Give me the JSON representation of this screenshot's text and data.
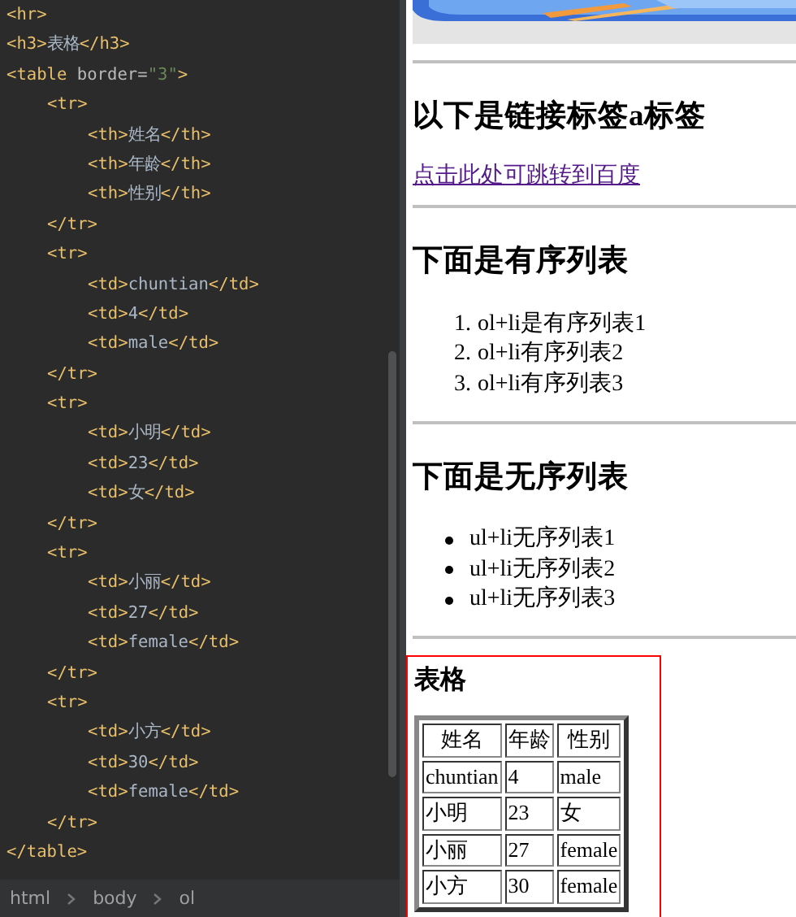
{
  "editor": {
    "lines": [
      {
        "tokens": [
          {
            "kind": "tag",
            "text": "<hr>"
          }
        ]
      },
      {
        "tokens": [
          {
            "kind": "tag",
            "text": "<h3>"
          },
          {
            "kind": "text",
            "text": "表格"
          },
          {
            "kind": "tag",
            "text": "</h3>"
          }
        ]
      },
      {
        "tokens": [
          {
            "kind": "tag",
            "text": "<table"
          },
          {
            "kind": "attr",
            "text": " border="
          },
          {
            "kind": "string",
            "text": "\"3\""
          },
          {
            "kind": "tag",
            "text": ">"
          }
        ],
        "children": [
          {
            "tokens": [
              {
                "kind": "tag",
                "text": "<tr>"
              }
            ],
            "children": [
              {
                "tokens": [
                  {
                    "kind": "tag",
                    "text": "<th>"
                  },
                  {
                    "kind": "text",
                    "text": "姓名"
                  },
                  {
                    "kind": "tag",
                    "text": "</th>"
                  }
                ]
              },
              {
                "tokens": [
                  {
                    "kind": "tag",
                    "text": "<th>"
                  },
                  {
                    "kind": "text",
                    "text": "年龄"
                  },
                  {
                    "kind": "tag",
                    "text": "</th>"
                  }
                ]
              },
              {
                "tokens": [
                  {
                    "kind": "tag",
                    "text": "<th>"
                  },
                  {
                    "kind": "text",
                    "text": "性别"
                  },
                  {
                    "kind": "tag",
                    "text": "</th>"
                  }
                ]
              }
            ]
          },
          {
            "tokens": [
              {
                "kind": "tag",
                "text": "</tr>"
              }
            ]
          },
          {
            "tokens": [
              {
                "kind": "tag",
                "text": "<tr>"
              }
            ],
            "children": [
              {
                "tokens": [
                  {
                    "kind": "tag",
                    "text": "<td>"
                  },
                  {
                    "kind": "text",
                    "text": "chuntian"
                  },
                  {
                    "kind": "tag",
                    "text": "</td>"
                  }
                ]
              },
              {
                "tokens": [
                  {
                    "kind": "tag",
                    "text": "<td>"
                  },
                  {
                    "kind": "text",
                    "text": "4"
                  },
                  {
                    "kind": "tag",
                    "text": "</td>"
                  }
                ]
              },
              {
                "tokens": [
                  {
                    "kind": "tag",
                    "text": "<td>"
                  },
                  {
                    "kind": "text",
                    "text": "male"
                  },
                  {
                    "kind": "tag",
                    "text": "</td>"
                  }
                ]
              }
            ]
          },
          {
            "tokens": [
              {
                "kind": "tag",
                "text": "</tr>"
              }
            ]
          },
          {
            "tokens": [
              {
                "kind": "tag",
                "text": "<tr>"
              }
            ],
            "children": [
              {
                "tokens": [
                  {
                    "kind": "tag",
                    "text": "<td>"
                  },
                  {
                    "kind": "text",
                    "text": "小明"
                  },
                  {
                    "kind": "tag",
                    "text": "</td>"
                  }
                ]
              },
              {
                "tokens": [
                  {
                    "kind": "tag",
                    "text": "<td>"
                  },
                  {
                    "kind": "text",
                    "text": "23"
                  },
                  {
                    "kind": "tag",
                    "text": "</td>"
                  }
                ]
              },
              {
                "tokens": [
                  {
                    "kind": "tag",
                    "text": "<td>"
                  },
                  {
                    "kind": "text",
                    "text": "女"
                  },
                  {
                    "kind": "tag",
                    "text": "</td>"
                  }
                ]
              }
            ]
          },
          {
            "tokens": [
              {
                "kind": "tag",
                "text": "</tr>"
              }
            ]
          },
          {
            "tokens": [
              {
                "kind": "tag",
                "text": "<tr>"
              }
            ],
            "children": [
              {
                "tokens": [
                  {
                    "kind": "tag",
                    "text": "<td>"
                  },
                  {
                    "kind": "text",
                    "text": "小丽"
                  },
                  {
                    "kind": "tag",
                    "text": "</td>"
                  }
                ]
              },
              {
                "tokens": [
                  {
                    "kind": "tag",
                    "text": "<td>"
                  },
                  {
                    "kind": "text",
                    "text": "27"
                  },
                  {
                    "kind": "tag",
                    "text": "</td>"
                  }
                ]
              },
              {
                "tokens": [
                  {
                    "kind": "tag",
                    "text": "<td>"
                  },
                  {
                    "kind": "text",
                    "text": "female"
                  },
                  {
                    "kind": "tag",
                    "text": "</td>"
                  }
                ]
              }
            ]
          },
          {
            "tokens": [
              {
                "kind": "tag",
                "text": "</tr>"
              }
            ]
          },
          {
            "tokens": [
              {
                "kind": "tag",
                "text": "<tr>"
              }
            ],
            "children": [
              {
                "tokens": [
                  {
                    "kind": "tag",
                    "text": "<td>"
                  },
                  {
                    "kind": "text",
                    "text": "小方"
                  },
                  {
                    "kind": "tag",
                    "text": "</td>"
                  }
                ]
              },
              {
                "tokens": [
                  {
                    "kind": "tag",
                    "text": "<td>"
                  },
                  {
                    "kind": "text",
                    "text": "30"
                  },
                  {
                    "kind": "tag",
                    "text": "</td>"
                  }
                ]
              },
              {
                "tokens": [
                  {
                    "kind": "tag",
                    "text": "<td>"
                  },
                  {
                    "kind": "text",
                    "text": "female"
                  },
                  {
                    "kind": "tag",
                    "text": "</td>"
                  }
                ]
              }
            ]
          },
          {
            "tokens": [
              {
                "kind": "tag",
                "text": "</tr>"
              }
            ]
          }
        ]
      },
      {
        "tokens": [
          {
            "kind": "tag",
            "text": "</table>"
          }
        ]
      }
    ],
    "breadcrumbs": [
      "html",
      "body",
      "ol"
    ]
  },
  "preview": {
    "blocks": [
      {
        "kind": "picture"
      },
      {
        "kind": "rule"
      },
      {
        "kind": "heading",
        "text": "以下是链接标签a标签"
      },
      {
        "kind": "link",
        "text": "点击此处可跳转到百度"
      },
      {
        "kind": "rule"
      },
      {
        "kind": "heading",
        "text": "下面是有序列表"
      },
      {
        "kind": "ordered_list",
        "items": [
          {
            "marker": "1.",
            "text": "ol+li是有序列表1"
          },
          {
            "marker": "2.",
            "text": "ol+li有序列表2"
          },
          {
            "marker": "3.",
            "text": "ol+li有序列表3"
          }
        ]
      },
      {
        "kind": "rule"
      },
      {
        "kind": "heading",
        "text": "下面是无序列表"
      },
      {
        "kind": "unordered_list",
        "items": [
          {
            "text": "ul+li无序列表1"
          },
          {
            "text": "ul+li无序列表2"
          },
          {
            "text": "ul+li无序列表3"
          }
        ]
      },
      {
        "kind": "rule"
      },
      {
        "kind": "table",
        "highlighted": true,
        "title": "表格",
        "columns": [
          "姓名",
          "年龄",
          "性别"
        ],
        "rows": [
          [
            "chuntian",
            "4",
            "male"
          ],
          [
            "小明",
            "23",
            "女"
          ],
          [
            "小丽",
            "27",
            "female"
          ],
          [
            "小方",
            "30",
            "female"
          ]
        ]
      }
    ]
  }
}
